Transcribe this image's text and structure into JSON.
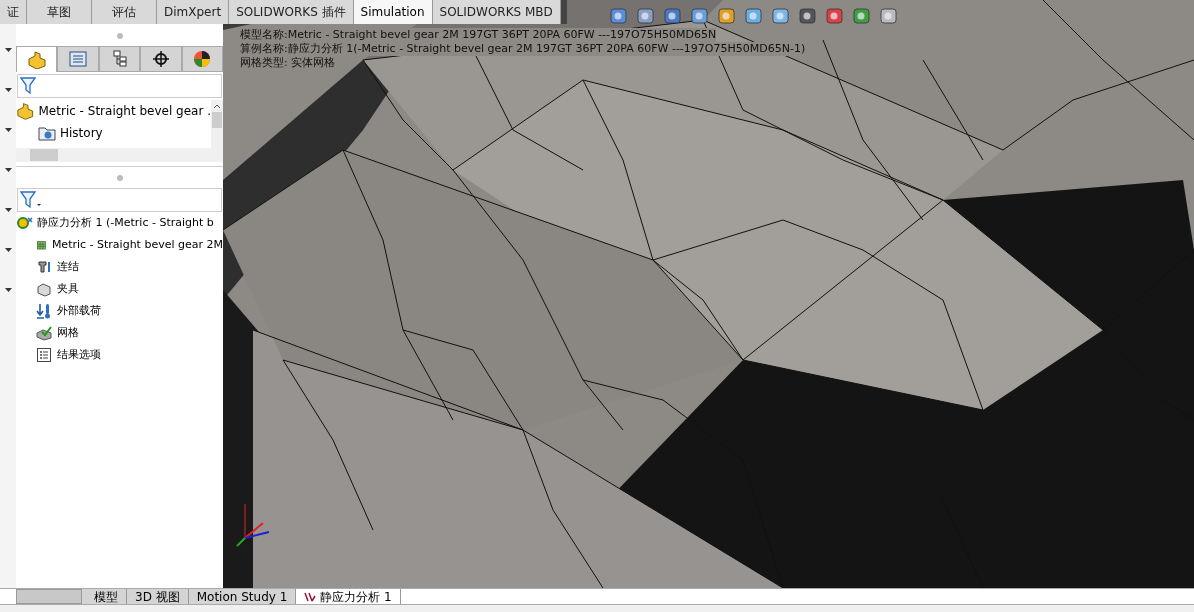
{
  "command_tabs": [
    {
      "label": "证",
      "selected": false
    },
    {
      "label": "草图",
      "selected": false
    },
    {
      "label": "评估",
      "selected": false
    },
    {
      "label": "DimXpert",
      "selected": false
    },
    {
      "label": "SOLIDWORKS 插件",
      "selected": false
    },
    {
      "label": "Simulation",
      "selected": true
    },
    {
      "label": "SOLIDWORKS MBD",
      "selected": false
    }
  ],
  "manager_tabs": [
    {
      "selected": true
    },
    {
      "selected": false
    },
    {
      "selected": false
    },
    {
      "selected": false
    },
    {
      "selected": false
    }
  ],
  "feature_tree": {
    "root": "Metric - Straight bevel gear .",
    "children": [
      "History"
    ]
  },
  "study_tree": {
    "root": "静应力分析 1 (-Metric - Straight b",
    "children": [
      {
        "kind": "part",
        "label": "Metric - Straight bevel gear 2M"
      },
      {
        "kind": "connection",
        "label": "连结"
      },
      {
        "kind": "fixture",
        "label": "夹具"
      },
      {
        "kind": "load",
        "label": "外部载荷"
      },
      {
        "kind": "mesh",
        "label": "网格"
      },
      {
        "kind": "results",
        "label": "结果选项"
      }
    ]
  },
  "viewport_info": [
    "模型名称:Metric - Straight bevel gear 2M 197GT 36PT 20PA 60FW ---197O75H50MD65N",
    "算例名称:静应力分析 1(-Metric - Straight bevel gear 2M 197GT 36PT 20PA 60FW ---197O75H50MD65N-1)",
    "网格类型: 实体网格"
  ],
  "bottom_tabs": [
    {
      "label": "模型",
      "selected": false,
      "kind": "plain"
    },
    {
      "label": "3D 视图",
      "selected": false,
      "kind": "plain"
    },
    {
      "label": "Motion Study 1",
      "selected": false,
      "kind": "plain"
    },
    {
      "label": "静应力分析 1",
      "selected": true,
      "kind": "study"
    }
  ]
}
